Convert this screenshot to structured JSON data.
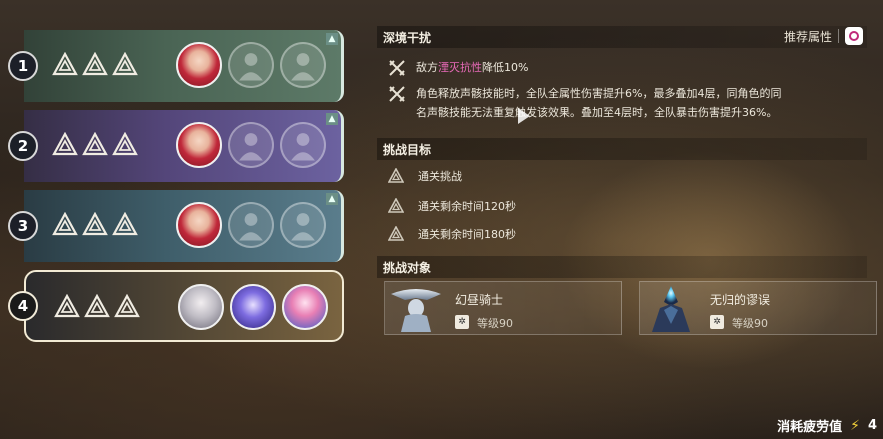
{
  "stages": [
    {
      "number": "1",
      "theme": "green",
      "active": false,
      "avatars": [
        "hero",
        "empty",
        "empty"
      ]
    },
    {
      "number": "2",
      "theme": "purple",
      "active": false,
      "avatars": [
        "hero",
        "empty",
        "empty"
      ]
    },
    {
      "number": "3",
      "theme": "teal",
      "active": false,
      "avatars": [
        "hero",
        "empty",
        "empty"
      ]
    },
    {
      "number": "4",
      "theme": "gold",
      "active": true,
      "avatars": [
        "silver",
        "blue",
        "pink"
      ]
    }
  ],
  "disturbance": {
    "title": "深境干扰",
    "recommend_label": "推荐属性",
    "effect1_prefix": "敌方",
    "effect1_highlight": "湮灭抗性",
    "effect1_suffix": "降低10%",
    "effect2_line1": "角色释放声骸技能时，全队全属性伤害提升6%，最多叠加4层，同角色的同",
    "effect2_line2": "名声骸技能无法重复触发该效果。叠加至4层时，全队暴击伤害提升36%。",
    "highlight_color": "#e86ab8"
  },
  "goals": {
    "title": "挑战目标",
    "items": [
      "通关挑战",
      "通关剩余时间120秒",
      "通关剩余时间180秒"
    ]
  },
  "targets": {
    "title": "挑战对象",
    "items": [
      {
        "name": "幻昼骑士",
        "level": "等级90"
      },
      {
        "name": "无归的谬误",
        "level": "等级90"
      }
    ]
  },
  "cost": {
    "label": "消耗疲劳值",
    "value": "4"
  }
}
